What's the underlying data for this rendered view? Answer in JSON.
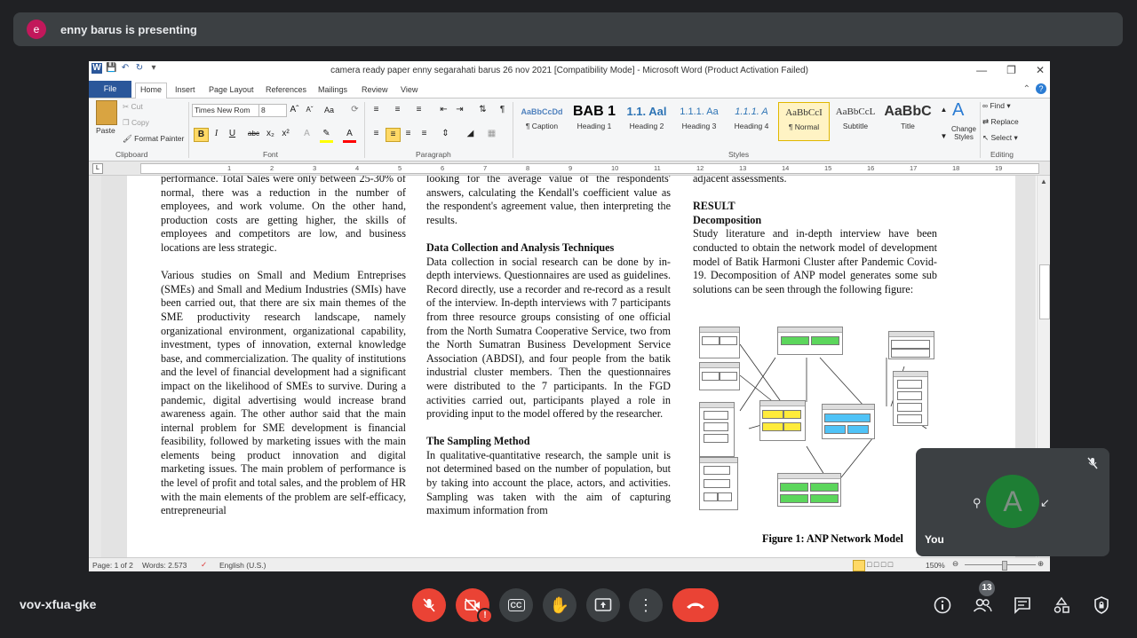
{
  "presenter_banner": {
    "avatar_letter": "e",
    "text": "enny barus is presenting"
  },
  "word": {
    "title": "camera ready paper enny segarahati barus 26 nov 2021 [Compatibility Mode] - Microsoft Word (Product Activation Failed)",
    "menu": {
      "file": "File",
      "tabs": [
        "Home",
        "Insert",
        "Page Layout",
        "References",
        "Mailings",
        "Review",
        "View"
      ]
    },
    "ribbon": {
      "clipboard": {
        "cut": "Cut",
        "copy": "Copy",
        "paste": "Paste",
        "format_painter": "Format Painter",
        "group": "Clipboard"
      },
      "font": {
        "name": "Times New Rom",
        "size": "8",
        "group": "Font"
      },
      "paragraph": {
        "group": "Paragraph"
      },
      "styles": {
        "group": "Styles",
        "items": [
          {
            "preview": "AaBbCcDd",
            "name": "¶ Caption"
          },
          {
            "preview": "BAB 1",
            "name": "Heading 1"
          },
          {
            "preview": "1.1. Aal",
            "name": "Heading 2"
          },
          {
            "preview": "1.1.1. Aa",
            "name": "Heading 3"
          },
          {
            "preview": "1.1.1. A",
            "name": "Heading 4"
          },
          {
            "preview": "AaBbCcI",
            "name": "¶ Normal"
          },
          {
            "preview": "AaBbCcL",
            "name": "Subtitle"
          },
          {
            "preview": "AaBbC",
            "name": "Title"
          }
        ],
        "change_styles": "Change Styles"
      },
      "editing": {
        "find": "Find",
        "replace": "Replace",
        "select": "Select",
        "group": "Editing"
      }
    },
    "ruler_numbers": [
      "1",
      "2",
      "3",
      "4",
      "5",
      "6",
      "7",
      "8",
      "9",
      "10",
      "11",
      "12",
      "13",
      "14",
      "15",
      "16",
      "17",
      "18",
      "19"
    ],
    "document": {
      "col1": [
        "performance. Total Sales were only between 25-30% of normal, there was a reduction in the number of employees, and work volume. On the other hand, production costs are getting higher, the skills of employees and competitors are low, and business locations are less strategic.",
        "Various studies on Small and Medium Entreprises (SMEs) and Small and Medium Industries (SMIs) have been carried out, that there are six main themes of the SME productivity research landscape, namely organizational environment, organizational capability, investment, types of innovation, external knowledge base, and commercialization. The quality of institutions and the level of financial development had a significant impact on the likelihood of SMEs to survive. During a pandemic, digital advertising would increase brand awareness again. The other author said that the main internal problem for SME development is financial feasibility, followed by marketing issues with the main elements being product innovation and digital marketing issues. The main problem of performance is the level of profit and total sales, and the problem of HR with the main elements of the problem are self-efficacy, entrepreneurial"
      ],
      "col2": {
        "intro": "looking for the average value of the respondents' answers, calculating the Kendall's coefficient value as the respondent's agreement value, then interpreting the results.",
        "heading1": "Data Collection and Analysis Techniques",
        "para1": "Data collection in social research can be done by in-depth interviews. Questionnaires are used as guidelines. Record directly, use a recorder and re-record as a result of the interview. In-depth interviews with 7 participants from three resource groups consisting of one official from the North Sumatra Cooperative Service, two from the North Sumatran Business Development Service Association (ABDSI), and four people from the batik industrial cluster members. Then the questionnaires were distributed to the 7 participants. In the FGD activities carried out, participants played a role in providing input to the model offered by the researcher.",
        "heading2": "The Sampling Method",
        "para2": "In qualitative-quantitative research, the sample unit is not determined based on the number of population, but by taking into account the place, actors, and activities. Sampling was taken with the aim of capturing maximum information from"
      },
      "col3": {
        "intro": "adjacent assessments.",
        "heading1": "RESULT",
        "heading2": "Decomposition",
        "para1": "Study literature and in-depth interview have been conducted to obtain the network model of development model of Batik Harmoni Cluster after Pandemic Covid-19. Decomposition of ANP model generates some sub solutions can be seen through the following figure:",
        "figure_caption": "Figure 1: ANP Network Model"
      }
    },
    "status": {
      "page": "Page: 1 of 2",
      "words": "Words: 2.573",
      "language": "English (U.S.)",
      "zoom": "150%"
    }
  },
  "self_tile": {
    "label": "You",
    "avatar_letter": "A",
    "avatar_color": "#1e7e34"
  },
  "meeting": {
    "code": "vov-xfua-gke",
    "participants_count": "13"
  },
  "colors": {
    "end_call": "#ea4335",
    "word_blue": "#2b579a",
    "meet_bg": "#202124",
    "tile_bg": "#3c4043"
  }
}
